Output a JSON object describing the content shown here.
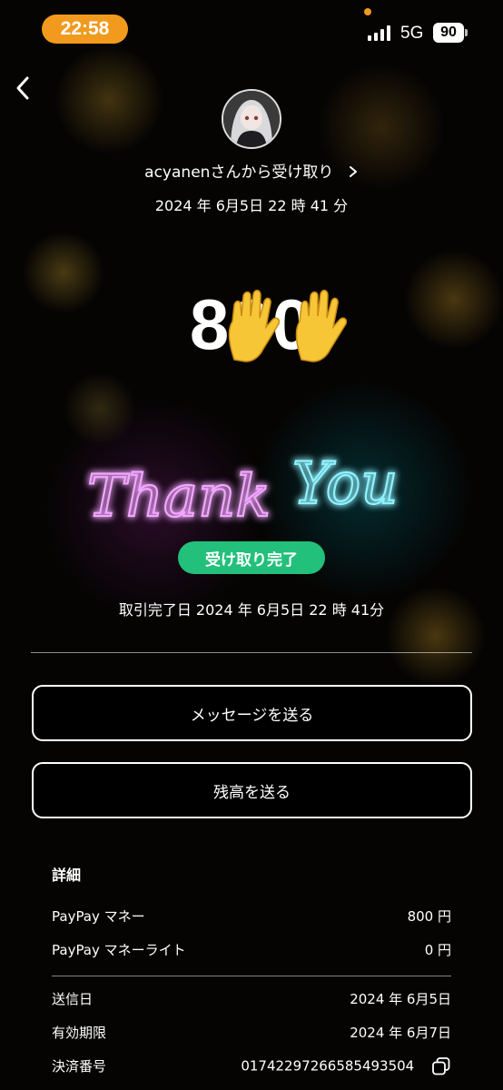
{
  "status_bar": {
    "time": "22:58",
    "network": "5G",
    "battery": "90"
  },
  "header": {
    "sender_line": "acyanenさんから受け取り",
    "datetime": "2024 年 6月5日 22 時 41 分"
  },
  "transaction": {
    "amount": "800",
    "thank_you_text": "Thank You",
    "status_badge": "受け取り完了",
    "completed_line": "取引完了日 2024 年 6月5日 22 時 41分"
  },
  "actions": {
    "send_message": "メッセージを送る",
    "send_balance": "残高を送る"
  },
  "details": {
    "heading": "詳細",
    "rows": [
      {
        "label": "PayPay マネー",
        "value": "800 円"
      },
      {
        "label": "PayPay マネーライト",
        "value": "0 円"
      }
    ],
    "rows2": [
      {
        "label": "送信日",
        "value": "2024 年 6月5日"
      },
      {
        "label": "有効期限",
        "value": "2024 年 6月7日"
      },
      {
        "label": "決済番号",
        "value": "01742297266585493504"
      }
    ]
  },
  "colors": {
    "accent_orange": "#f19a1e",
    "badge_green": "#22c07a",
    "neon_pink": "#e070ff",
    "neon_cyan": "#3fe4ff"
  },
  "icons": [
    "back-chevron-icon",
    "chevron-right-icon",
    "raised-hands-icon",
    "copy-icon",
    "signal-icon",
    "battery-icon"
  ]
}
